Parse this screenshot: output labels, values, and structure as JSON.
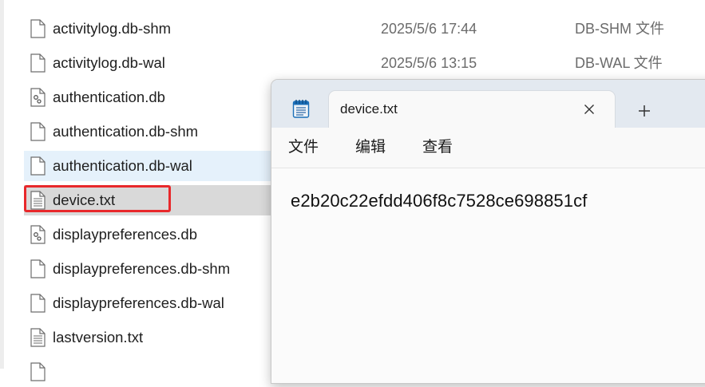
{
  "explorer": {
    "files": [
      {
        "name": "activitylog.db-shm",
        "date": "2025/5/6 17:44",
        "type": "DB-SHM 文件",
        "icon": "blank-file-icon"
      },
      {
        "name": "activitylog.db-wal",
        "date": "2025/5/6 13:15",
        "type": "DB-WAL 文件",
        "icon": "blank-file-icon"
      },
      {
        "name": "authentication.db",
        "date": "",
        "type": "",
        "icon": "database-file-icon"
      },
      {
        "name": "authentication.db-shm",
        "date": "",
        "type": "",
        "icon": "blank-file-icon"
      },
      {
        "name": "authentication.db-wal",
        "date": "",
        "type": "",
        "icon": "blank-file-icon"
      },
      {
        "name": "device.txt",
        "date": "",
        "type": "",
        "icon": "text-file-icon"
      },
      {
        "name": "displaypreferences.db",
        "date": "",
        "type": "",
        "icon": "database-file-icon"
      },
      {
        "name": "displaypreferences.db-shm",
        "date": "",
        "type": "",
        "icon": "blank-file-icon"
      },
      {
        "name": "displaypreferences.db-wal",
        "date": "",
        "type": "",
        "icon": "blank-file-icon"
      },
      {
        "name": "lastversion.txt",
        "date": "",
        "type": "",
        "icon": "text-file-icon"
      }
    ],
    "hovered_file": "authentication.db-wal",
    "selected_file": "device.txt",
    "highlight_color": "#e8282b"
  },
  "notepad": {
    "tab_title": "device.txt",
    "close_icon": "close-icon",
    "new_tab_symbol": "+",
    "menu": [
      "文件",
      "编辑",
      "查看"
    ],
    "content": "e2b20c22efdd406f8c7528ce698851cf"
  }
}
